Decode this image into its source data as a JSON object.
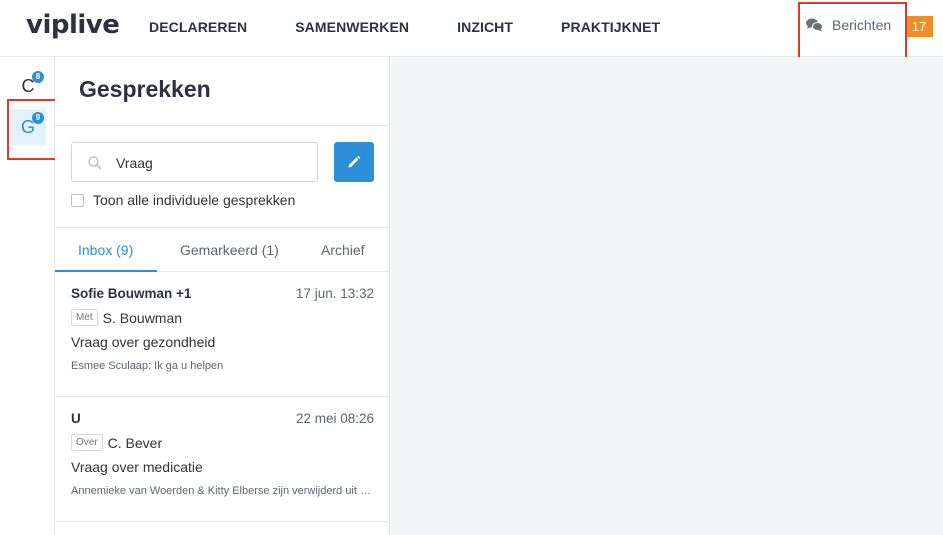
{
  "header": {
    "logo": "viplive",
    "nav": [
      "DECLAREREN",
      "SAMENWERKEN",
      "INZICHT",
      "PRAKTIJKNET"
    ],
    "messages_label": "Berichten",
    "messages_count": "17"
  },
  "rail": {
    "items": [
      {
        "letter": "C",
        "badge": "8"
      },
      {
        "letter": "G",
        "badge": "9"
      }
    ]
  },
  "panel": {
    "title": "Gesprekken",
    "search_value": "Vraag",
    "checkbox_label": "Toon alle individuele gesprekken",
    "tabs": [
      "Inbox (9)",
      "Gemarkeerd (1)",
      "Archief"
    ]
  },
  "conversations": [
    {
      "name": "Sofie Bouwman +1",
      "date": "17 jun. 13:32",
      "tag": "Met",
      "person": "S. Bouwman",
      "subject": "Vraag over gezondheid",
      "preview": "Esmee Sculaap: Ik ga u helpen"
    },
    {
      "name": "U",
      "date": "22 mei 08:26",
      "tag": "Over",
      "person": "C. Bever",
      "subject": "Vraag over medicatie",
      "preview": "Annemieke van Woerden & Kitty Elberse zijn verwijderd uit het gesprek"
    }
  ],
  "colors": {
    "accent": "#2d8fd5",
    "badge_orange": "#f28c28",
    "highlight_red": "#e0392b"
  },
  "icons": {
    "messages": "chat-bubbles-icon",
    "search": "search-icon",
    "compose": "pencil-icon"
  }
}
